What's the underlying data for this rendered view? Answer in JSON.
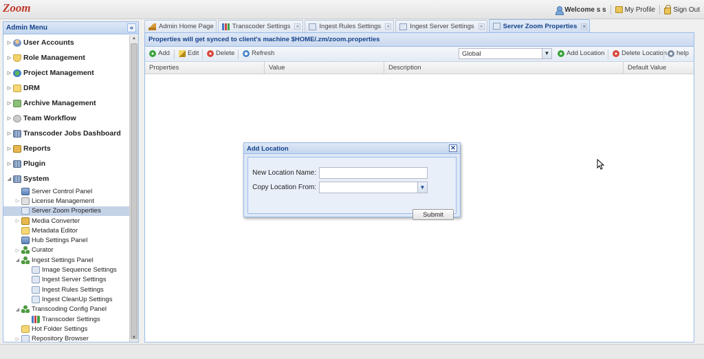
{
  "header": {
    "logo_text": "Zoom",
    "welcome_prefix": "Welcome",
    "user_name": "s s",
    "my_profile": "My Profile",
    "sign_out": "Sign Out"
  },
  "sidebar": {
    "title": "Admin Menu",
    "collapse_glyph": "«",
    "top_items": [
      {
        "label": "User Accounts",
        "icon": "users-icon"
      },
      {
        "label": "Role Management",
        "icon": "role-icon"
      },
      {
        "label": "Project Management",
        "icon": "project-icon"
      },
      {
        "label": "DRM",
        "icon": "folder-icon"
      },
      {
        "label": "Archive Management",
        "icon": "archive-icon"
      },
      {
        "label": "Team Workflow",
        "icon": "team-icon"
      },
      {
        "label": "Transcoder Jobs Dashboard",
        "icon": "dashboard-icon"
      },
      {
        "label": "Reports",
        "icon": "reports-icon"
      },
      {
        "label": "Plugin",
        "icon": "plugin-icon"
      },
      {
        "label": "System",
        "icon": "system-icon"
      }
    ],
    "system_children": [
      {
        "label": "Server Control Panel",
        "icon": "server-icon"
      },
      {
        "label": "License Management",
        "icon": "license-icon"
      },
      {
        "label": "Server Zoom Properties",
        "icon": "page-icon",
        "selected": true
      },
      {
        "label": "Media Converter",
        "icon": "media-icon"
      },
      {
        "label": "Metadata Editor",
        "icon": "metadata-icon"
      },
      {
        "label": "Hub Settings Panel",
        "icon": "server-icon"
      },
      {
        "label": "Curator",
        "icon": "tree-icon"
      },
      {
        "label": "Ingest Settings Panel",
        "icon": "tree-icon"
      },
      {
        "label": "Image Sequence Settings",
        "icon": "page-icon"
      },
      {
        "label": "Ingest Server Settings",
        "icon": "page-icon"
      },
      {
        "label": "Ingest Rules Settings",
        "icon": "page-icon"
      },
      {
        "label": "Ingest CleanUp Settings",
        "icon": "page-icon"
      },
      {
        "label": "Transcoding Config Panel",
        "icon": "tree-icon"
      },
      {
        "label": "Transcoder Settings",
        "icon": "bars-icon"
      },
      {
        "label": "Hot Folder Settings",
        "icon": "folder-icon"
      },
      {
        "label": "Repository Browser",
        "icon": "page-icon"
      }
    ]
  },
  "tabs": [
    {
      "label": "Admin Home Page",
      "icon": "home-icon",
      "closable": false
    },
    {
      "label": "Transcoder Settings",
      "icon": "bars-icon",
      "closable": true
    },
    {
      "label": "Ingest Rules Settings",
      "icon": "page-icon",
      "closable": true
    },
    {
      "label": "Ingest Server Settings",
      "icon": "page-icon",
      "closable": true
    },
    {
      "label": "Server Zoom Properties",
      "icon": "page-icon",
      "closable": true,
      "active": true
    }
  ],
  "main": {
    "panel_title": "Properties will get synced to client's machine $HOME/.zm/zoom.properties",
    "toolbar": {
      "add": "Add",
      "edit": "Edit",
      "delete": "Delete",
      "refresh": "Refresh",
      "location_value": "Global",
      "add_location": "Add Location",
      "delete_location": "Delete Location",
      "help": "help"
    },
    "columns": [
      "Properties",
      "Value",
      "Description",
      "Default Value"
    ]
  },
  "dialog": {
    "title": "Add Location",
    "new_location_label": "New Location Name:",
    "new_location_value": "",
    "copy_from_label": "Copy Location From:",
    "copy_from_value": "",
    "submit_label": "Submit",
    "close_glyph": "✕"
  },
  "colors": {
    "accent": "#15428b",
    "panel_border": "#99bbe8",
    "selection": "#c5d3e8"
  }
}
